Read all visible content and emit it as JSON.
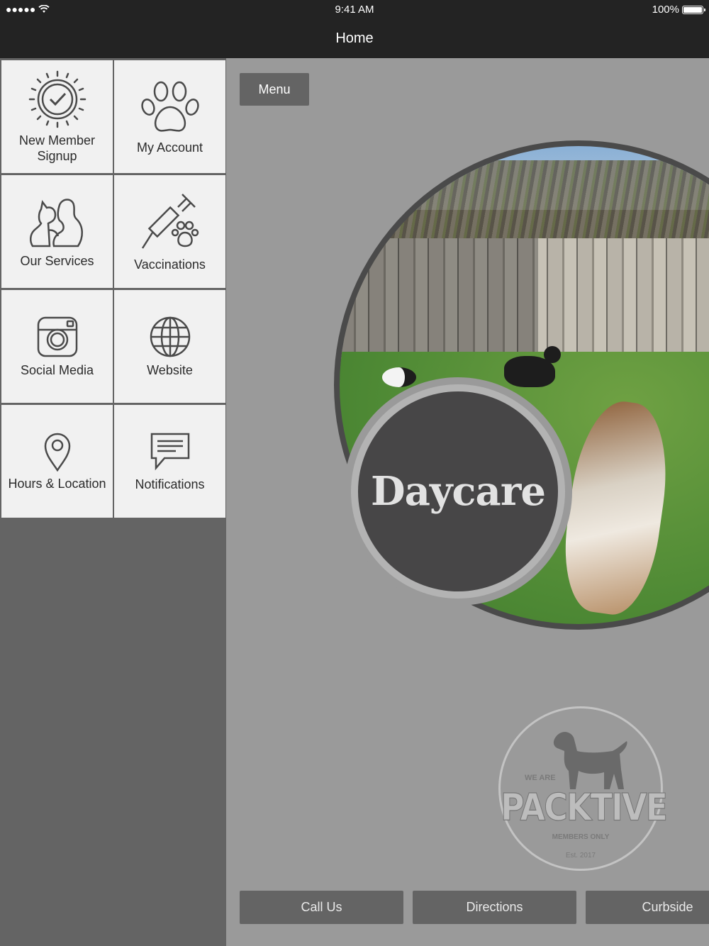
{
  "status_bar": {
    "signal": "●●●●●",
    "time": "9:41 AM",
    "battery": "100%"
  },
  "navbar": {
    "title": "Home"
  },
  "tiles": [
    {
      "label": "New Member Signup",
      "icon": "badge-check-icon"
    },
    {
      "label": "My Account",
      "icon": "paw-icon"
    },
    {
      "label": "Our Services",
      "icon": "pets-icon"
    },
    {
      "label": "Vaccinations",
      "icon": "syringe-paw-icon"
    },
    {
      "label": "Social Media",
      "icon": "instagram-icon"
    },
    {
      "label": "Website",
      "icon": "globe-icon"
    },
    {
      "label": "Hours & Location",
      "icon": "map-pin-icon"
    },
    {
      "label": "Notifications",
      "icon": "chat-icon"
    }
  ],
  "main": {
    "menu_label": "Menu",
    "hero_label": "Daycare",
    "logo": {
      "we_are": "WE ARE",
      "brand": "PACKTIVE",
      "members": "MEMBERS ONLY",
      "est": "Est. 2017"
    },
    "bottom_buttons": [
      "Call Us",
      "Directions",
      "Curbside"
    ]
  },
  "colors": {
    "topbar": "#232323",
    "sidebar": "#646464",
    "main_bg": "#9a9a9a",
    "tile_bg": "#f1f1f1",
    "button_bg": "#646464"
  }
}
